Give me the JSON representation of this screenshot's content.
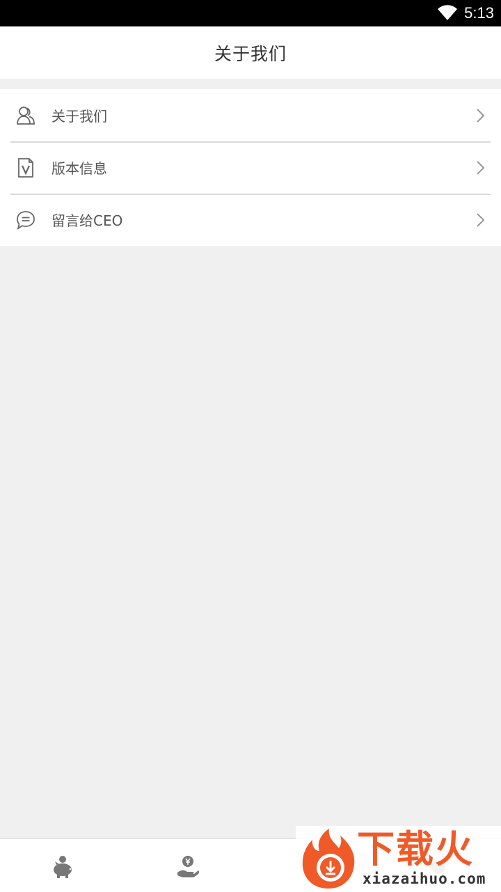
{
  "status_bar": {
    "time": "5:13",
    "wifi_icon": "wifi-icon"
  },
  "header": {
    "title": "关于我们"
  },
  "menu": {
    "items": [
      {
        "label": "关于我们",
        "icon": "users-icon"
      },
      {
        "label": "版本信息",
        "icon": "version-document-icon"
      },
      {
        "label": "留言给CEO",
        "icon": "chat-bubble-icon"
      }
    ]
  },
  "tab_bar": {
    "tabs": [
      {
        "icon": "piggy-bank-icon"
      },
      {
        "icon": "hand-coin-icon"
      },
      {
        "icon": "tab-icon"
      },
      {
        "icon": "tab-icon"
      }
    ]
  },
  "watermark": {
    "text_cn": "下载火",
    "text_en": "xiazaihuo.com"
  },
  "colors": {
    "accent": "#f05a28",
    "background": "#f0f0f0",
    "icon_gray": "#666666"
  }
}
